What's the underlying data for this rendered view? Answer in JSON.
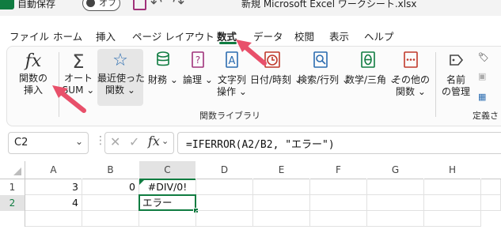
{
  "titlebar": {
    "autosave_label": "自動保存",
    "autosave_state": "オフ",
    "doc_title": "新規 Microsoft Excel ワークシート.xlsx"
  },
  "tabs": [
    {
      "label": "ファイル"
    },
    {
      "label": "ホーム"
    },
    {
      "label": "挿入"
    },
    {
      "label": "ページ レイアウト"
    },
    {
      "label": "数式",
      "active": true
    },
    {
      "label": "データ"
    },
    {
      "label": "校閲"
    },
    {
      "label": "表示"
    },
    {
      "label": "ヘルプ"
    }
  ],
  "ribbon": {
    "insert_function": {
      "line1": "関数の",
      "line2": "挿入"
    },
    "autosum": {
      "line1": "オート",
      "line2": "SUM"
    },
    "recent": {
      "line1": "最近使った",
      "line2": "関数"
    },
    "financial": {
      "line1": "財務"
    },
    "logical": {
      "line1": "論理"
    },
    "text": {
      "line1": "文字列",
      "line2": "操作"
    },
    "datetime": {
      "line1": "日付/時刻"
    },
    "lookup": {
      "line1": "検索/行列"
    },
    "math": {
      "line1": "数学/三角"
    },
    "more": {
      "line1": "その他の",
      "line2": "関数"
    },
    "name_manager": {
      "line1": "名前",
      "line2": "の管理"
    },
    "group_label": "関数ライブラリ",
    "group_label2": "定義さ"
  },
  "formula_bar": {
    "name_box": "C2",
    "fx_label": "fx",
    "formula": "=IFERROR(A2/B2, \"エラー\")"
  },
  "grid": {
    "columns": [
      "A",
      "B",
      "C",
      "D",
      "E",
      "F",
      "G",
      "H"
    ],
    "rows": [
      {
        "num": "1",
        "A": "3",
        "B": "0",
        "C": "#DIV/0!"
      },
      {
        "num": "2",
        "A": "4",
        "B": "",
        "C": "エラー"
      }
    ]
  },
  "colors": {
    "accent": "#107c41",
    "arrow": "#e8506a"
  }
}
